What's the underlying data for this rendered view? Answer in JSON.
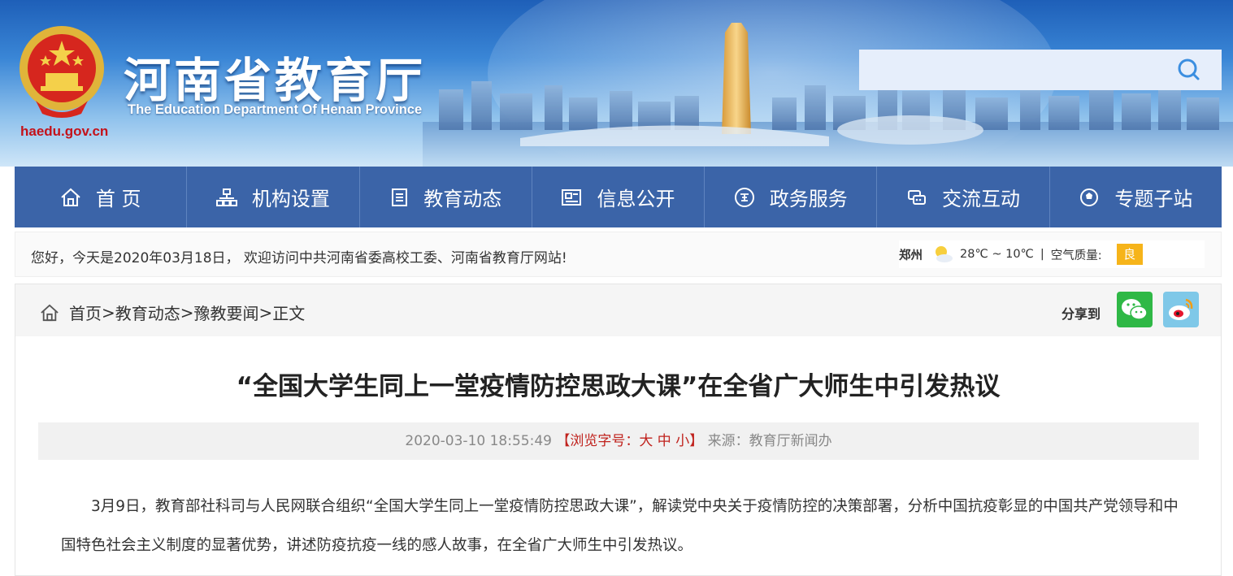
{
  "header": {
    "site_title": "河南省教育厅",
    "site_subtitle": "The Education Department Of Henan Province",
    "site_domain": "haedu.gov.cn",
    "search": {
      "placeholder": ""
    }
  },
  "nav": {
    "items": [
      {
        "label": "首 页",
        "icon": "home-icon"
      },
      {
        "label": "机构设置",
        "icon": "org-chart-icon"
      },
      {
        "label": "教育动态",
        "icon": "document-list-icon"
      },
      {
        "label": "信息公开",
        "icon": "info-card-icon"
      },
      {
        "label": "政务服务",
        "icon": "gov-seal-icon"
      },
      {
        "label": "交流互动",
        "icon": "chat-icon"
      },
      {
        "label": "专题子站",
        "icon": "globe-icon"
      }
    ]
  },
  "welcome": {
    "text": "您好，今天是2020年03月18日， 欢迎访问中共河南省委高校工委、河南省教育厅网站!",
    "weather": {
      "city": "郑州",
      "temp": "28℃ ~ 10℃",
      "sep": "|",
      "aq_label": "空气质量:",
      "aq_value": "良",
      "aq_color": "#f6b41a"
    }
  },
  "breadcrumb": {
    "home": "首页",
    "sep1": " >",
    "c1": "教育动态",
    "sep2": ">",
    "c2": "豫教要闻",
    "sep3": " >",
    "current": "正文"
  },
  "share": {
    "label": "分享到"
  },
  "article": {
    "title": "“全国大学生同上一堂疫情防控思政大课”在全省广大师生中引发热议",
    "datetime": "2020-03-10 18:55:49",
    "font_prefix": "【浏览字号：",
    "font_large": "大",
    "font_medium": "中",
    "font_small": "小",
    "font_suffix": "】",
    "source": "来源：教育厅新闻办",
    "paragraph1": "3月9日，教育部社科司与人民网联合组织“全国大学生同上一堂疫情防控思政大课”，解读党中央关于疫情防控的决策部署，分析中国抗疫彰显的中国共产党领导和中国特色社会主义制度的显著优势，讲述防疫抗疫一线的感人故事，在全省广大师生中引发热议。"
  },
  "colors": {
    "nav_bg": "#3b64a8",
    "accent_red": "#c0221d",
    "domain_red": "#c4121a"
  }
}
